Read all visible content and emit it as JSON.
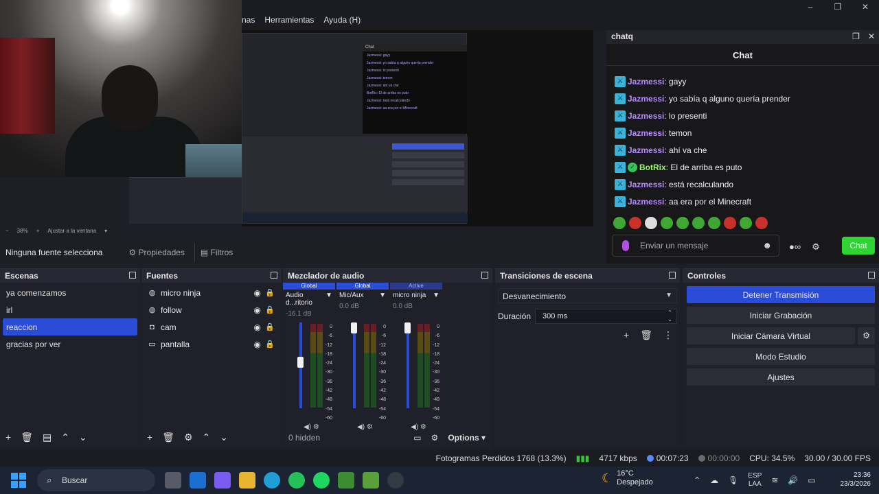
{
  "menu": {
    "items": [
      "nas",
      "Herramientas",
      "Ayuda (H)"
    ]
  },
  "window_controls": [
    "–",
    "❐",
    "✕"
  ],
  "preview": {
    "zoom_label": "38%",
    "fit_label": "Ajustar a la ventana",
    "nested_chat_title": "Chat",
    "nested_lines": [
      "Jazmessi: gayy",
      "Jazmessi: yo sabía q alguno quería prender",
      "Jazmessi: lo presenti",
      "Jazmessi: temon",
      "Jazmessi: ahí va che",
      "BotRix: El de arriba es puto",
      "Jazmessi: está recalculando",
      "Jazmessi: aa era por el Minecraft"
    ]
  },
  "chat_dock": {
    "dock_title": "chatq",
    "header": "Chat",
    "messages": [
      {
        "user": "Jazmessi",
        "text": ": gayy",
        "bot": false
      },
      {
        "user": "Jazmessi",
        "text": ": yo sabía q alguno quería prender",
        "bot": false
      },
      {
        "user": "Jazmessi",
        "text": ": lo presenti",
        "bot": false
      },
      {
        "user": "Jazmessi",
        "text": ": temon",
        "bot": false
      },
      {
        "user": "Jazmessi",
        "text": ": ahí va che",
        "bot": false
      },
      {
        "user": "BotRix",
        "text": ": El de arriba es puto",
        "bot": true
      },
      {
        "user": "Jazmessi",
        "text": ": está recalculando",
        "bot": false
      },
      {
        "user": "Jazmessi",
        "text": ": aa era por el Minecraft",
        "bot": false
      }
    ],
    "input_placeholder": "Enviar un mensaje",
    "send_label": "Chat",
    "user_color": "#b78bff",
    "bot_color": "#9afc6a",
    "send_color": "#2fd332"
  },
  "source_bar": {
    "status": "Ninguna fuente selecciona",
    "properties": "Propiedades",
    "filters": "Filtros"
  },
  "scenes": {
    "title": "Escenas",
    "items": [
      "ya comenzamos",
      "irl",
      "reaccion",
      "gracias por ver"
    ],
    "selected": "reaccion"
  },
  "sources": {
    "title": "Fuentes",
    "items": [
      {
        "name": "micro ninja",
        "icon": "globe-icon"
      },
      {
        "name": "follow",
        "icon": "globe-icon"
      },
      {
        "name": "cam",
        "icon": "camera-icon"
      },
      {
        "name": "pantalla",
        "icon": "monitor-icon"
      }
    ]
  },
  "mixer": {
    "title": "Mezclador de audio",
    "channels": [
      {
        "tag": "Global",
        "name": "Audio d...ritorio",
        "db": "-16.1 dB",
        "level": 0.55
      },
      {
        "tag": "Global",
        "name": "Mic/Aux",
        "db": "0.0 dB",
        "level": 1.0
      },
      {
        "tag": "Active",
        "name": "micro ninja",
        "db": "0.0 dB",
        "level": 1.0
      }
    ],
    "scale": [
      "0",
      "-6",
      "-12",
      "-18",
      "-24",
      "-30",
      "-36",
      "-42",
      "-48",
      "-54",
      "-60"
    ],
    "hidden_label": "0 hidden",
    "options_label": "Options"
  },
  "transitions": {
    "title": "Transiciones de escena",
    "selected": "Desvanecimiento",
    "duration_label": "Duración",
    "duration_value": "300 ms"
  },
  "controls": {
    "title": "Controles",
    "buttons": [
      "Detener Transmisión",
      "Iniciar Grabación",
      "Iniciar Cámara Virtual",
      "Modo Estudio",
      "Ajustes"
    ]
  },
  "status": {
    "dropped": "Fotogramas Perdidos 1768 (13.3%)",
    "bitrate": "4717 kbps",
    "stream_time": "00:07:23",
    "rec_time": "00:00:00",
    "cpu": "CPU: 34.5%",
    "fps": "30.00 / 30.00 FPS"
  },
  "taskbar": {
    "search": "Buscar",
    "temp": "16°C",
    "weather": "Despejado",
    "lang_top": "ESP",
    "lang_bottom": "LAA",
    "time": "23:36",
    "date": "23/3/2026"
  }
}
